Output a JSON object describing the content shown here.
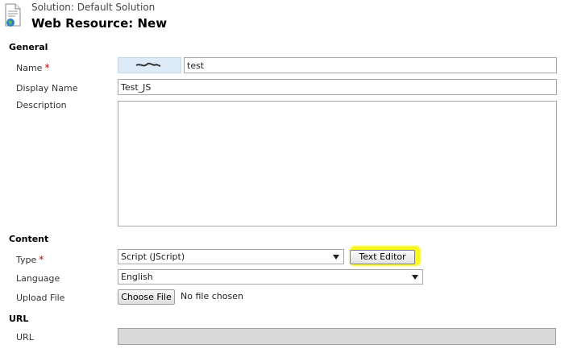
{
  "header": {
    "subtitle": "Solution: Default Solution",
    "title": "Web Resource: New"
  },
  "sections": {
    "general": "General",
    "content": "Content",
    "url": "URL"
  },
  "form": {
    "name_label": "Name",
    "required_mark": "*",
    "name_value": "test",
    "display_name_label": "Display Name",
    "display_name_value": "Test_JS",
    "description_label": "Description",
    "description_value": "",
    "type_label": "Type",
    "type_value": "Script (JScript)",
    "text_editor_button": "Text Editor",
    "language_label": "Language",
    "language_value": "English",
    "upload_file_label": "Upload File",
    "choose_file_button": "Choose File",
    "no_file_text": "No file chosen",
    "url_label": "URL",
    "url_value": ""
  },
  "colors": {
    "required": "#c00000",
    "highlight": "#f7f71c",
    "prefix_bg": "#ddebf9"
  }
}
